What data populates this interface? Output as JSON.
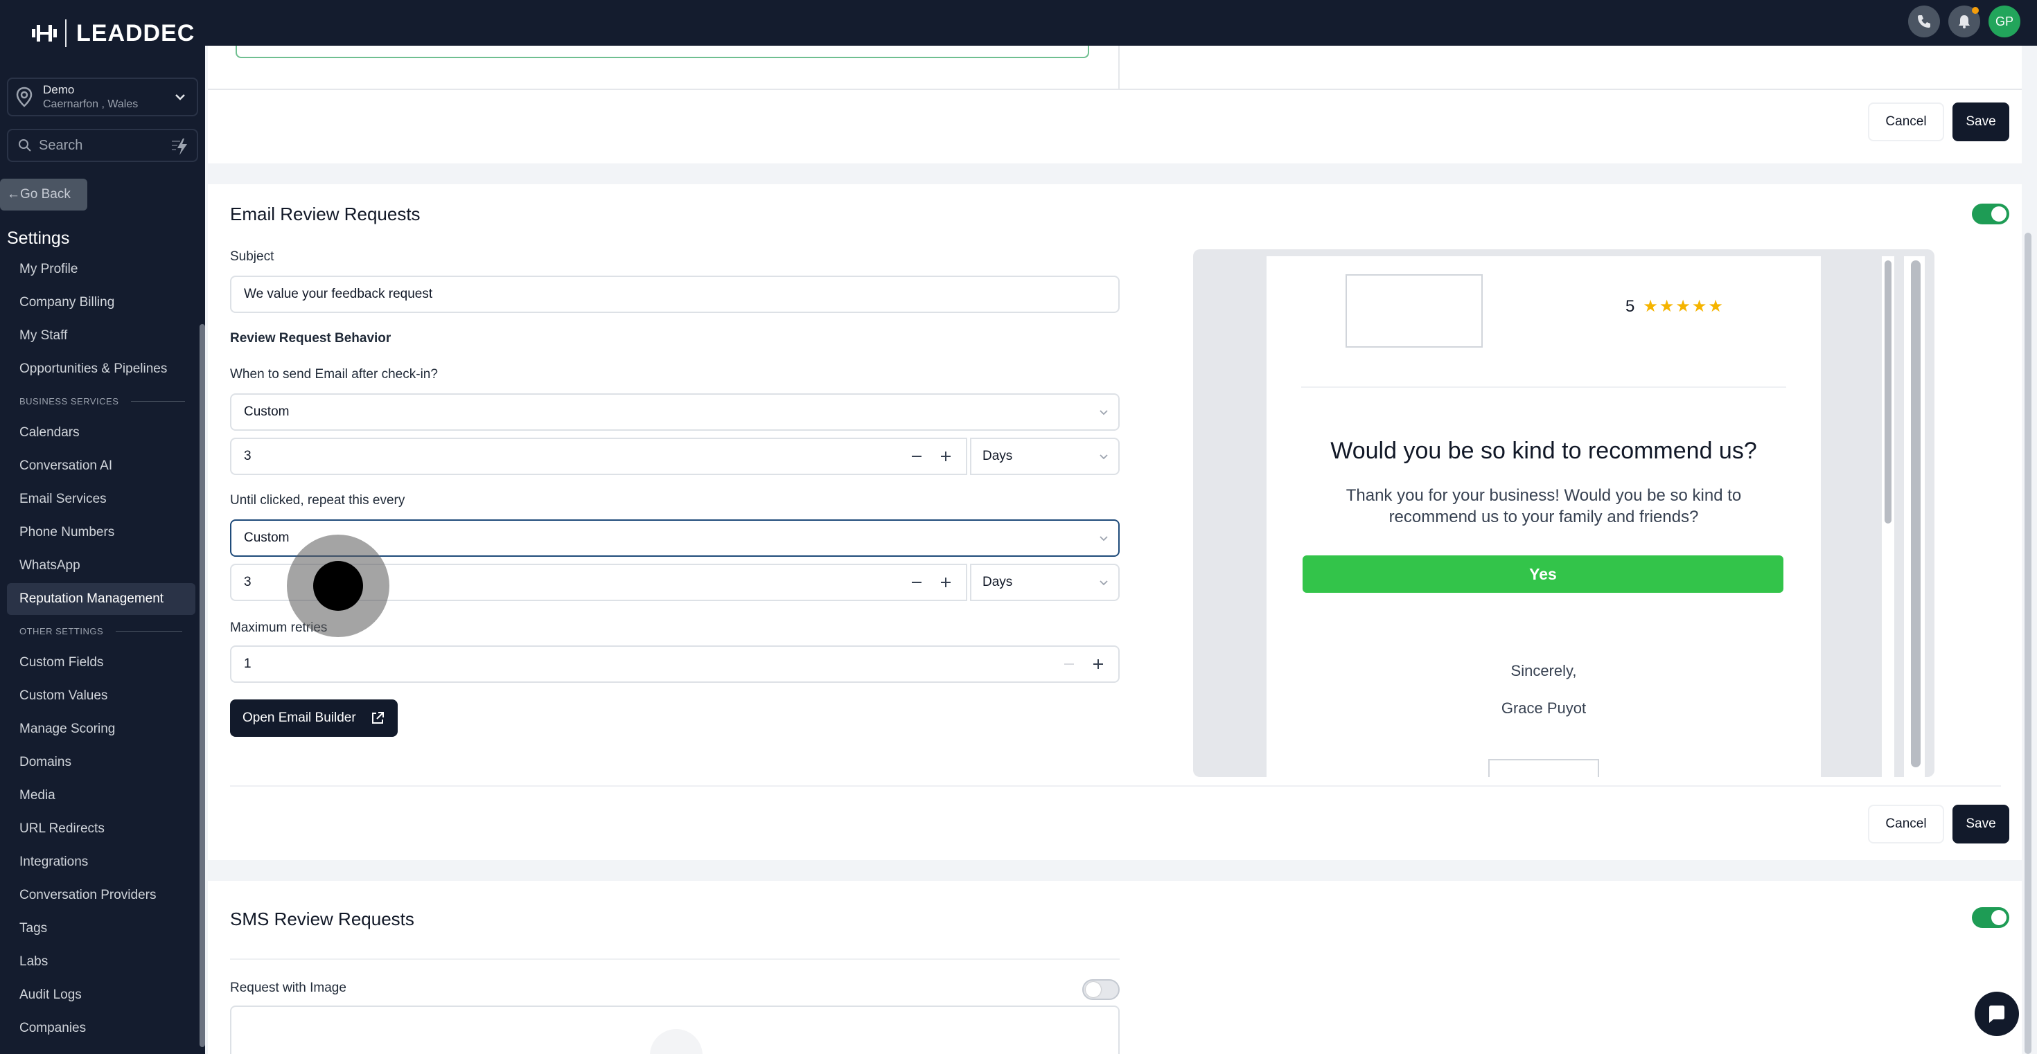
{
  "brand": {
    "name": "LEADDEC"
  },
  "location": {
    "name": "Demo",
    "address": "Caernarfon , Wales"
  },
  "search": {
    "placeholder": "Search"
  },
  "go_back": "Go Back",
  "settings_title": "Settings",
  "nav": {
    "items_top": [
      "My Profile",
      "Company Billing",
      "My Staff",
      "Opportunities & Pipelines"
    ],
    "section_business": "BUSINESS SERVICES",
    "items_business": [
      "Calendars",
      "Conversation AI",
      "Email Services",
      "Phone Numbers",
      "WhatsApp",
      "Reputation Management"
    ],
    "section_other": "OTHER SETTINGS",
    "items_other": [
      "Custom Fields",
      "Custom Values",
      "Manage Scoring",
      "Domains",
      "Media",
      "URL Redirects",
      "Integrations",
      "Conversation Providers",
      "Tags",
      "Labs",
      "Audit Logs",
      "Companies"
    ],
    "active": "Reputation Management"
  },
  "topbar": {
    "avatar_initials": "GP",
    "icons": [
      "phone-icon",
      "bell-icon"
    ],
    "notification_color": "#f59e0b"
  },
  "actions": {
    "cancel": "Cancel",
    "save": "Save"
  },
  "email_section": {
    "title": "Email Review Requests",
    "enabled": true,
    "subject_label": "Subject",
    "subject_value": "We value your feedback request",
    "behavior_label": "Review Request Behavior",
    "when_label": "When to send Email after check-in?",
    "when_value": "Custom",
    "when_amount": "3",
    "when_unit": "Days",
    "repeat_label": "Until clicked, repeat this every",
    "repeat_value": "Custom",
    "repeat_amount": "3",
    "repeat_unit": "Days",
    "max_retries_label": "Maximum retries",
    "max_retries_value": "1",
    "open_builder": "Open Email Builder"
  },
  "preview": {
    "rating_value": "5",
    "stars": "★★★★★",
    "headline": "Would you be so kind to recommend us?",
    "body": "Thank you for your business! Would you be so kind to recommend us to your family and friends?",
    "yes_button": "Yes",
    "signoff": "Sincerely,",
    "signer": "Grace Puyot",
    "button_color": "#33c44a"
  },
  "sms_section": {
    "title": "SMS Review Requests",
    "enabled": true,
    "image_label": "Request with Image",
    "image_enabled": false
  },
  "colors": {
    "sidebar": "#141c2e",
    "accent_green": "#1e9c55",
    "primary_button": "#121a2b"
  }
}
